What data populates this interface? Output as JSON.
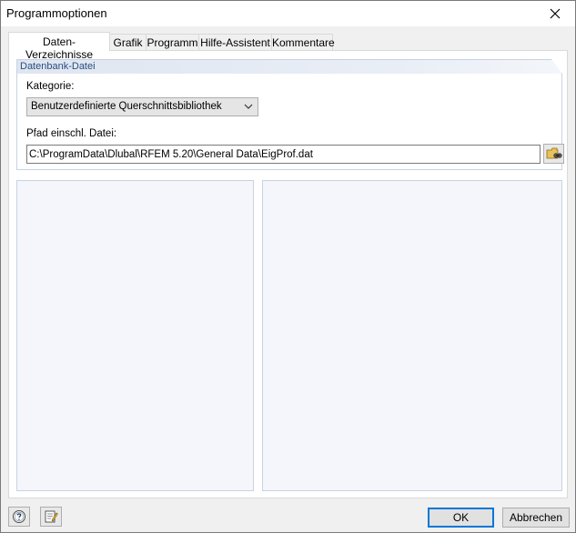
{
  "window": {
    "title": "Programmoptionen"
  },
  "tabs": [
    {
      "label": "Daten-Verzeichnisse",
      "active": true
    },
    {
      "label": "Grafik",
      "active": false
    },
    {
      "label": "Programm",
      "active": false
    },
    {
      "label": "Hilfe-Assistent",
      "active": false
    },
    {
      "label": "Kommentare",
      "active": false
    }
  ],
  "database_group": {
    "title": "Datenbank-Datei",
    "category_label": "Kategorie:",
    "category_value": "Benutzerdefinierte Querschnittsbibliothek",
    "path_label": "Pfad einschl. Datei:",
    "path_value": "C:\\ProgramData\\Dlubal\\RFEM 5.20\\General Data\\EigProf.dat"
  },
  "buttons": {
    "ok": "OK",
    "cancel": "Abbrechen"
  },
  "icons": {
    "close": "close-icon",
    "dropdown": "chevron-down-icon",
    "browse": "folder-browse-icon",
    "help": "help-icon",
    "edit": "edit-notes-icon"
  },
  "colors": {
    "group_header": "#dfe6f1",
    "group_title": "#2a4d7f",
    "panel_bg": "#f4f6fb",
    "default_button_border": "#0078d7"
  }
}
